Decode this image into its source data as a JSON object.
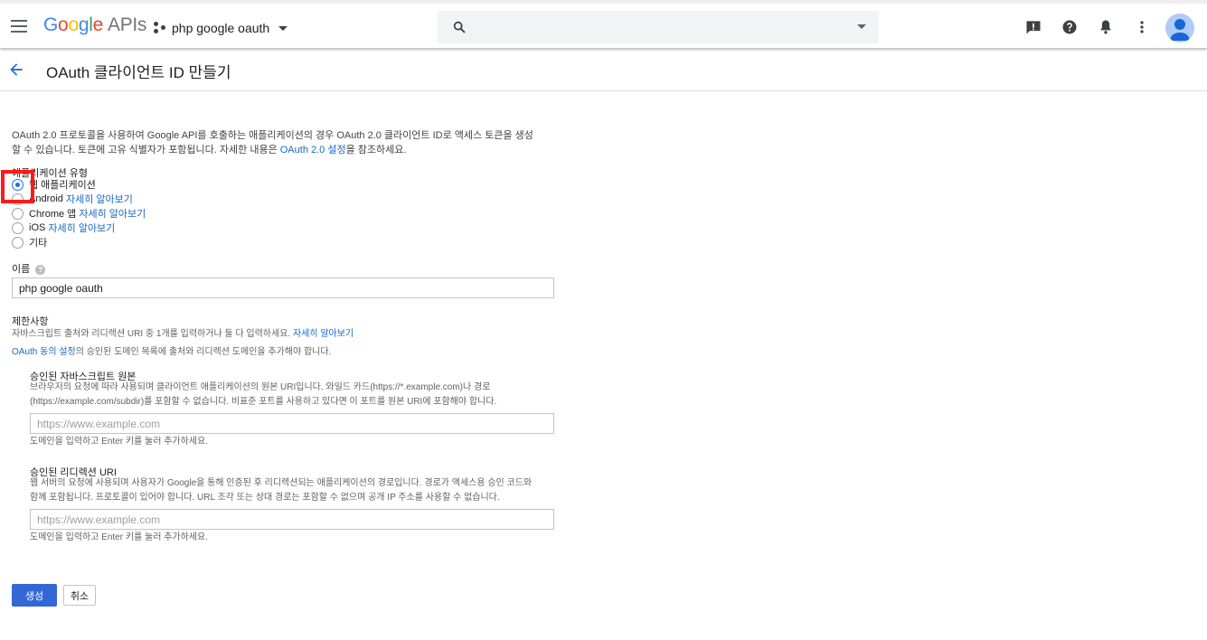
{
  "topbar": {
    "logo": {
      "g1": "G",
      "g2": "o",
      "g3": "o",
      "g4": "g",
      "g5": "l",
      "g6": "e",
      "apis": "APIs"
    },
    "project_name": "php google oauth"
  },
  "header": {
    "title": "OAuth 클라이언트 ID 만들기"
  },
  "intro": {
    "line1": "OAuth 2.0 프로토콜을 사용하여 Google API를 호출하는 애플리케이션의 경우 OAuth 2.0 클라이언트 ID로 액세스 토큰을 생성",
    "line2_pre": "할 수 있습니다. 토큰에 고유 식별자가 포함됩니다. 자세한 내용은 ",
    "line2_link": "OAuth 2.0 설정",
    "line2_post": "을 참조하세요."
  },
  "app_type": {
    "label": "애플리케이션 유형",
    "options": [
      {
        "label": "웹 애플리케이션",
        "link": ""
      },
      {
        "label": "Android",
        "link": "자세히 알아보기"
      },
      {
        "label": "Chrome 앱",
        "link": "자세히 알아보기"
      },
      {
        "label": "iOS",
        "link": "자세히 알아보기"
      },
      {
        "label": "기타",
        "link": ""
      }
    ],
    "selected_index": 0
  },
  "name_field": {
    "label": "이름",
    "help": "?",
    "value": "php google oauth"
  },
  "restrictions": {
    "title": "제한사항",
    "desc_pre": "자바스크립트 출처와 리디렉션 URI 중 1개를 입력하거나 둘 다 입력하세요. ",
    "desc_link": "자세히 알아보기",
    "consent_link": "OAuth 동의 설정",
    "consent_post": "의 승인된 도메인 목록에 출처와 리디렉션 도메인을 추가해야 합니다.",
    "js_origins": {
      "title": "승인된 자바스크립트 원본",
      "desc1": "브라우저의 요청에 따라 사용되며 클라이언트 애플리케이션의 원본 URI입니다. 와일드 카드(https://*.example.com)나 경로",
      "desc2": "(https://example.com/subdir)를 포함할 수 없습니다. 비표준 포트를 사용하고 있다면 이 포트를 원본 URI에 포함해야 합니다.",
      "placeholder": "https://www.example.com",
      "hint": "도메인을 입력하고 Enter 키를 눌러 추가하세요."
    },
    "redirect_uris": {
      "title": "승인된 리디렉션 URI",
      "desc1": "웹 서버의 요청에 사용되며 사용자가 Google을 통해 인증된 후 리디렉션되는 애플리케이션의 경로입니다. 경로가 액세스용 승인 코드와",
      "desc2": "함께 포함됩니다. 프로토콜이 있어야 합니다. URL 조각 또는 상대 경로는 포함할 수 없으며 공개 IP 주소를 사용할 수 없습니다.",
      "placeholder": "https://www.example.com",
      "hint": "도메인을 입력하고 Enter 키를 눌러 추가하세요."
    }
  },
  "actions": {
    "create": "생성",
    "cancel": "취소"
  },
  "colors": {
    "primary": "#3367d6",
    "link": "#1a66c8",
    "highlight": "#ff1a1a"
  }
}
